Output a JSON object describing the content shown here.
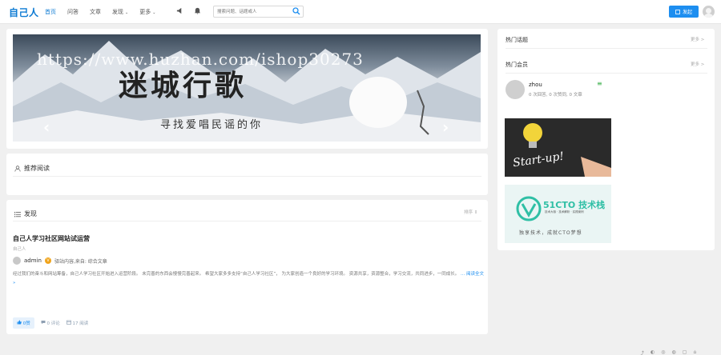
{
  "brand": {
    "logo": "自己人"
  },
  "nav": {
    "items": [
      {
        "label": "首页",
        "active": true
      },
      {
        "label": "问答",
        "active": false
      },
      {
        "label": "文章",
        "active": false
      },
      {
        "label": "发现",
        "active": false,
        "caret": "⌄"
      },
      {
        "label": "更多",
        "active": false,
        "caret": "⌄"
      }
    ],
    "icons": [
      "megaphone-icon",
      "bell-icon"
    ]
  },
  "search": {
    "placeholder": "搜索问题、话题或人",
    "value": ""
  },
  "publish": {
    "label": "发起",
    "color": "#1d8ef0"
  },
  "banner": {
    "title": "迷城行歌",
    "subtitle": "寻找爱唱民谣的你",
    "watermark": "https://www.huzhan.com/ishop30273"
  },
  "recommend": {
    "title": "推荐阅读"
  },
  "discover": {
    "title": "发现",
    "sort_label": "排序 ⇕",
    "articles": [
      {
        "title": "自己人学习社区网站试运营",
        "source": "自己人",
        "author": "admin",
        "meta": "  驿站内容,来自: 综合文章",
        "excerpt": "经过我们的奋斗和网站筹备，自己人学习社区开始进入运营阶段。 未完善的东西会慢慢完善起来。 希望大家多多支持“自己人学习社区”， 为大家创造一个良好的学习环境。 资源共享，资源整合，学习交流，共同进步，一同成长。",
        "more": "... 阅读全文 »",
        "likes": "0赞",
        "comments": "0 评论",
        "reads": "17 阅读"
      }
    ]
  },
  "sidebar": {
    "hot_topics": {
      "title": "热门话题",
      "more": "更多 >"
    },
    "hot_members": {
      "title": "热门会员",
      "more": "更多 >",
      "members": [
        {
          "name": "zhou",
          "stats": "0 次回答, 0 次赞同, 0 文章"
        }
      ]
    },
    "ad1": {
      "text": "Start-up!"
    },
    "ad2": {
      "brand": "51CTO 技术栈",
      "small": "技术大咖 · 技术解析 · 实践案例",
      "slogan": "独享技术，成就CTO梦想"
    }
  },
  "footer": {
    "icons": [
      "share-icon",
      "qq-icon",
      "weixin-icon",
      "weibo-icon",
      "copy-icon",
      "top-icon"
    ]
  }
}
